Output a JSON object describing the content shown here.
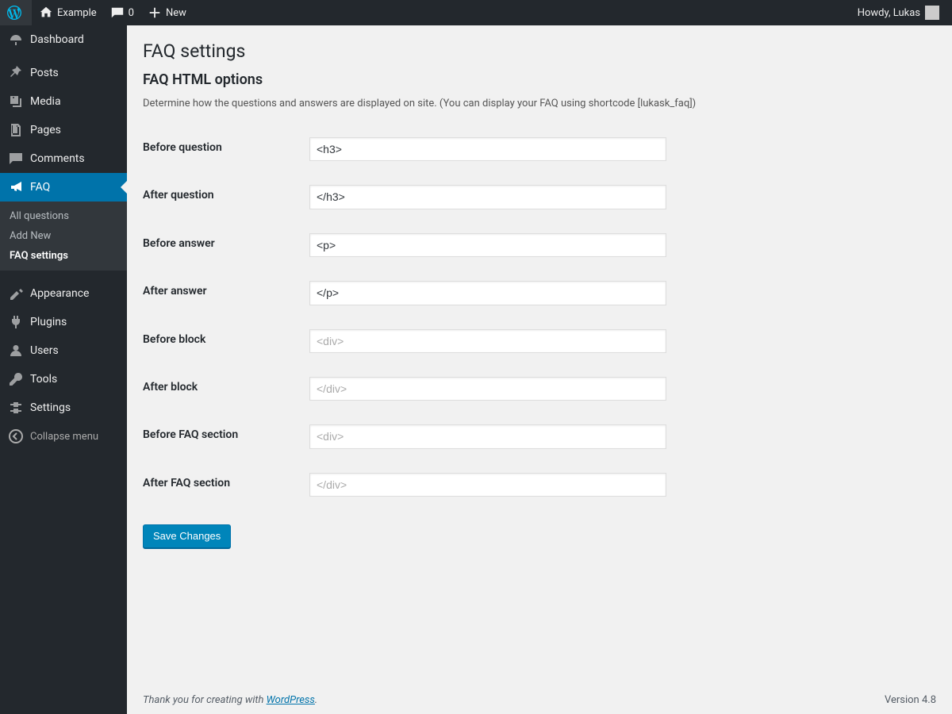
{
  "toolbar": {
    "site_name": "Example",
    "comments_count": "0",
    "new_label": "New",
    "howdy_prefix": "Howdy, ",
    "user_name": "Lukas"
  },
  "sidebar": {
    "items": [
      {
        "id": "dashboard",
        "label": "Dashboard",
        "icon": "dashboard"
      },
      {
        "id": "posts",
        "label": "Posts",
        "icon": "pin"
      },
      {
        "id": "media",
        "label": "Media",
        "icon": "media"
      },
      {
        "id": "pages",
        "label": "Pages",
        "icon": "pages"
      },
      {
        "id": "comments",
        "label": "Comments",
        "icon": "comments"
      },
      {
        "id": "faq",
        "label": "FAQ",
        "icon": "megaphone",
        "current": true
      },
      {
        "id": "appearance",
        "label": "Appearance",
        "icon": "appearance"
      },
      {
        "id": "plugins",
        "label": "Plugins",
        "icon": "plugin"
      },
      {
        "id": "users",
        "label": "Users",
        "icon": "users"
      },
      {
        "id": "tools",
        "label": "Tools",
        "icon": "tools"
      },
      {
        "id": "settings",
        "label": "Settings",
        "icon": "settings"
      }
    ],
    "submenu": [
      {
        "label": "All questions"
      },
      {
        "label": "Add New"
      },
      {
        "label": "FAQ settings",
        "active": true
      }
    ],
    "collapse_label": "Collapse menu"
  },
  "page": {
    "title": "FAQ settings",
    "subtitle": "FAQ HTML options",
    "description": "Determine how the questions and answers are displayed on site. (You can display your FAQ using shortcode [lukask_faq])",
    "fields": [
      {
        "label": "Before question",
        "value": "<h3>",
        "placeholder": ""
      },
      {
        "label": "After question",
        "value": "</h3>",
        "placeholder": ""
      },
      {
        "label": "Before answer",
        "value": "<p>",
        "placeholder": ""
      },
      {
        "label": "After answer",
        "value": "</p>",
        "placeholder": ""
      },
      {
        "label": "Before block",
        "value": "",
        "placeholder": "<div>"
      },
      {
        "label": "After block",
        "value": "",
        "placeholder": "</div>"
      },
      {
        "label": "Before FAQ section",
        "value": "",
        "placeholder": "<div>"
      },
      {
        "label": "After FAQ section",
        "value": "",
        "placeholder": "</div>"
      }
    ],
    "save_label": "Save Changes"
  },
  "footer": {
    "thanks_prefix": "Thank you for creating with ",
    "link_text": "WordPress",
    "suffix": ".",
    "version": "Version 4.8"
  }
}
